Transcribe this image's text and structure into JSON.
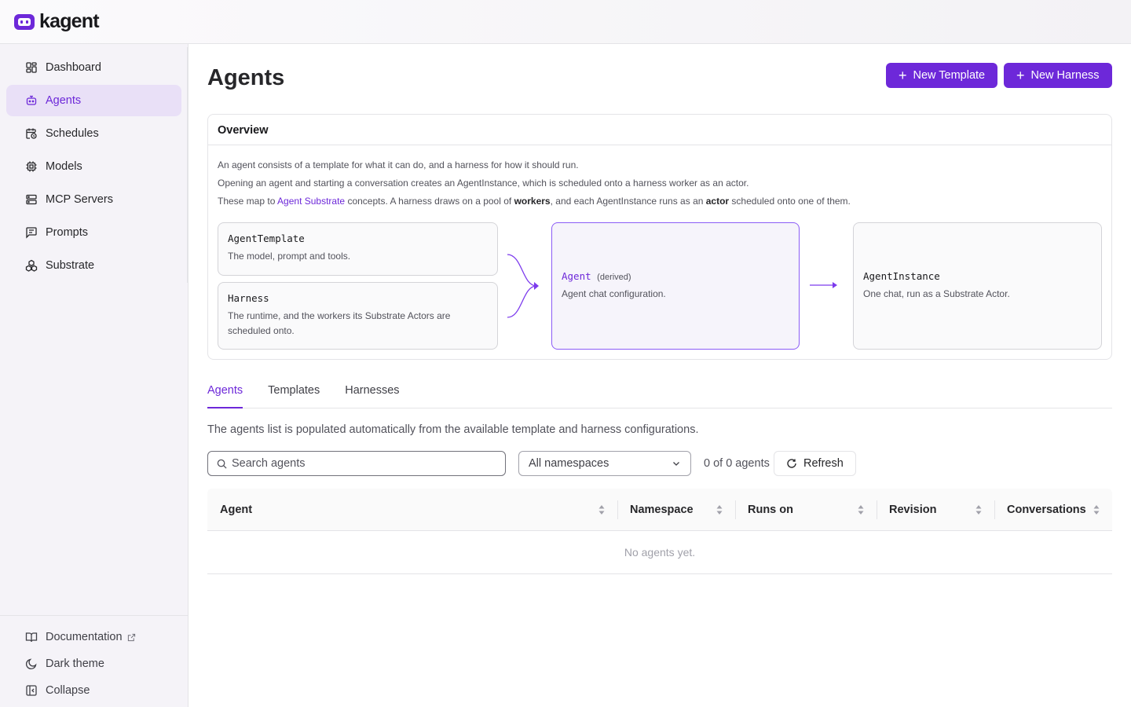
{
  "app": {
    "name": "kagent",
    "accent": "#6d28d9"
  },
  "sidebar": {
    "items": [
      {
        "label": "Dashboard",
        "icon": "dashboard-icon",
        "active": false
      },
      {
        "label": "Agents",
        "icon": "bot-icon",
        "active": true
      },
      {
        "label": "Schedules",
        "icon": "calendar-clock-icon",
        "active": false
      },
      {
        "label": "Models",
        "icon": "cpu-icon",
        "active": false
      },
      {
        "label": "MCP Servers",
        "icon": "server-icon",
        "active": false
      },
      {
        "label": "Prompts",
        "icon": "message-square-text-icon",
        "active": false
      },
      {
        "label": "Substrate",
        "icon": "boxes-icon",
        "active": false
      }
    ],
    "bottom": {
      "documentation": "Documentation",
      "dark_theme": "Dark theme",
      "collapse": "Collapse"
    }
  },
  "page": {
    "title": "Agents",
    "new_template": "New Template",
    "new_harness": "New Harness"
  },
  "overview": {
    "heading": "Overview",
    "line1": "An agent consists of a template for what it can do, and a harness for how it should run.",
    "line2": "Opening an agent and starting a conversation creates an AgentInstance, which is scheduled onto a harness worker as an actor.",
    "line3_a": "These map to ",
    "line3_link": "Agent Substrate",
    "line3_b": " concepts. A harness draws on a pool of ",
    "line3_workers": "workers",
    "line3_c": ", and each AgentInstance runs as an ",
    "line3_actor": "actor",
    "line3_d": " scheduled onto one of them.",
    "template": {
      "title": "AgentTemplate",
      "desc": "The model, prompt and tools."
    },
    "harness": {
      "title": "Harness",
      "desc": "The runtime, and the workers its Substrate Actors are scheduled onto."
    },
    "agent": {
      "title": "Agent",
      "tag": "(derived)",
      "desc": "Agent chat configuration."
    },
    "instance": {
      "title": "AgentInstance",
      "desc": "One chat, run as a Substrate Actor."
    }
  },
  "tabs": [
    "Agents",
    "Templates",
    "Harnesses"
  ],
  "active_tab": "Agents",
  "helper_text": "The agents list is populated automatically from the available template and harness configurations.",
  "search": {
    "placeholder": "Search agents"
  },
  "namespace_select": "All namespaces",
  "count_text": "0 of 0 agents",
  "refresh": "Refresh",
  "table": {
    "columns": [
      "Agent",
      "Namespace",
      "Runs on",
      "Revision",
      "Conversations"
    ],
    "empty": "No agents yet."
  }
}
